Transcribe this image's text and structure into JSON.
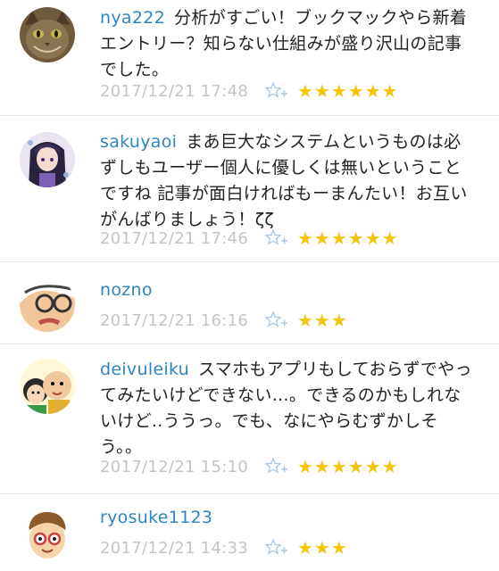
{
  "comments": [
    {
      "username": "nya222",
      "text": "分析がすごい！ブックマックやら新着エントリー？知らない仕組みが盛り沢山の記事でした。",
      "timestamp": "2017/12/21 17:48",
      "stars": "★★★★★★"
    },
    {
      "username": "sakuyaoi",
      "text": "まあ巨大なシステムというものは必ずしもユーザー個人に優しくは無いということですね 記事が面白ければもーまんたい！お互いがんばりましょう！ζζ",
      "timestamp": "2017/12/21 17:46",
      "stars": "★★★★★★"
    },
    {
      "username": "nozno",
      "text": "",
      "timestamp": "2017/12/21 16:16",
      "stars": "★★★"
    },
    {
      "username": "deivuleiku",
      "text": "スマホもアプリもしておらずでやってみたいけどできない…。できるのかもしれないけど..ううっ。でも、なにやらむずかしそう。。",
      "timestamp": "2017/12/21 15:10",
      "stars": "★★★★★★"
    },
    {
      "username": "ryosuke1123",
      "text": "",
      "timestamp": "2017/12/21 14:33",
      "stars": "★★★"
    }
  ],
  "icons": {
    "add_star": "add-star-icon",
    "star_color": "#f2c40a",
    "username_color": "#2e86bf",
    "timestamp_color": "#c4c4c4"
  }
}
